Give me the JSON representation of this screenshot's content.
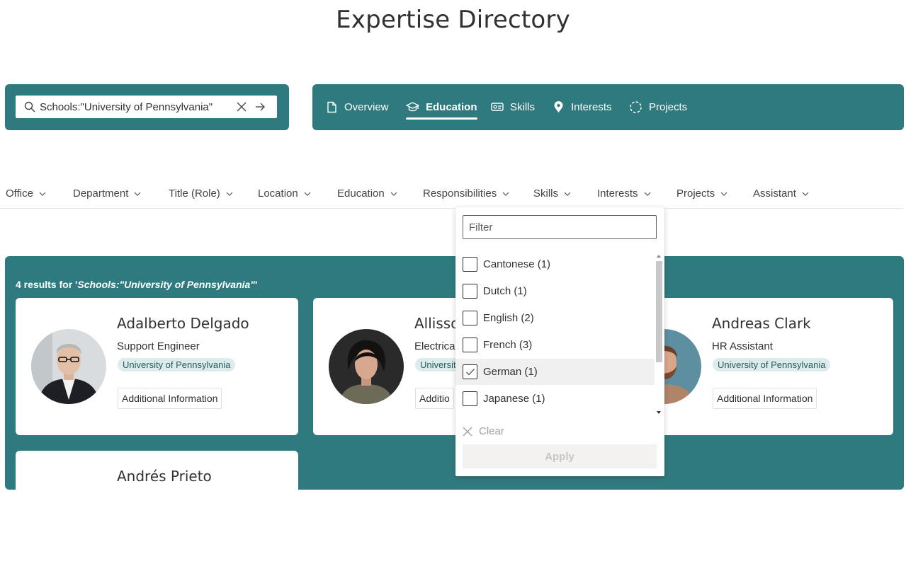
{
  "page": {
    "title": "Expertise Directory"
  },
  "search": {
    "value": "Schools:\"University of Pennsylvania\""
  },
  "tabs": [
    {
      "label": "Overview",
      "icon": "document-icon",
      "active": false
    },
    {
      "label": "Education",
      "icon": "graduation-cap-icon",
      "active": true
    },
    {
      "label": "Skills",
      "icon": "skills-icon",
      "active": false
    },
    {
      "label": "Interests",
      "icon": "location-pin-icon",
      "active": false
    },
    {
      "label": "Projects",
      "icon": "progress-ring-icon",
      "active": false
    }
  ],
  "filters": [
    "Office",
    "Department",
    "Title (Role)",
    "Location",
    "Education",
    "Responsibilities",
    "Skills",
    "Interests",
    "Projects",
    "Assistant"
  ],
  "results": {
    "prefix": "4 results for '",
    "query": "Schools:\"University of Pennsylvania\"",
    "suffix": "'"
  },
  "people": [
    {
      "name": "Adalberto Delgado",
      "role": "Support Engineer",
      "school": "University of Pennsylvania",
      "more": "Additional Information"
    },
    {
      "name": "Allisson",
      "role": "Electrical",
      "school": "Universit",
      "more": "Additio"
    },
    {
      "name": "Andreas Clark",
      "role": "HR Assistant",
      "school": "University of Pennsylvania",
      "more": "Additional Information"
    },
    {
      "name": "Andrés Prieto"
    }
  ],
  "dropdown": {
    "filter_placeholder": "Filter",
    "options": [
      {
        "label": "Cantonese (1)",
        "checked": false
      },
      {
        "label": "Dutch (1)",
        "checked": false
      },
      {
        "label": "English (2)",
        "checked": false
      },
      {
        "label": "French (3)",
        "checked": false
      },
      {
        "label": "German (1)",
        "checked": true
      },
      {
        "label": "Japanese (1)",
        "checked": false
      }
    ],
    "clear_label": "Clear",
    "apply_label": "Apply"
  },
  "colors": {
    "brand_teal": "#2f7a7e",
    "pill_bg": "#dcecec"
  }
}
